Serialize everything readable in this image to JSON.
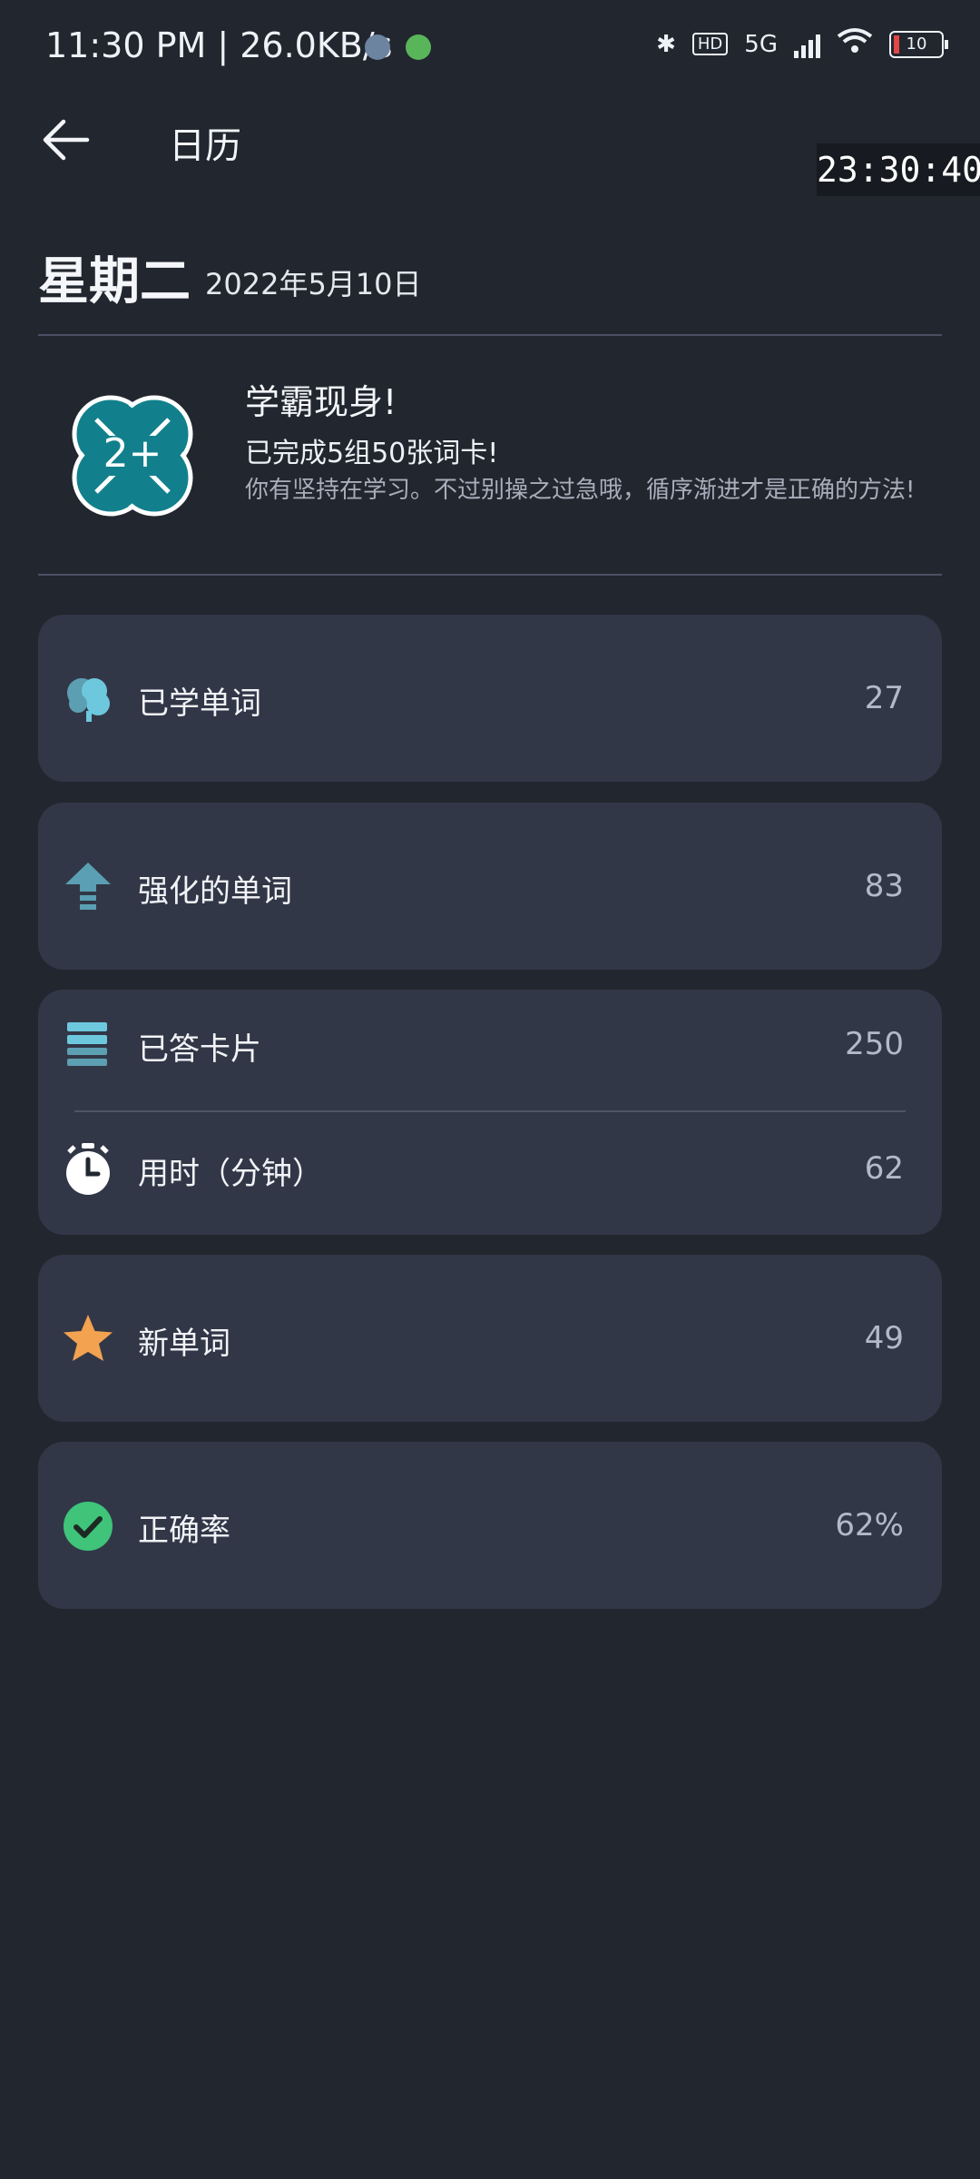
{
  "status_bar": {
    "time": "11:30 PM | 26.0KB/s",
    "network": "5G",
    "hd": "HD",
    "battery": "10"
  },
  "app_bar": {
    "title": "日历",
    "clock": "23:30:40"
  },
  "header": {
    "weekday": "星期二",
    "date": "2022年5月10日"
  },
  "achievement": {
    "badge_text": "2+",
    "title": "学霸现身!",
    "subtitle": "已完成5组50张词卡!",
    "description": "你有坚持在学习。不过别操之过急哦，循序渐进才是正确的方法!"
  },
  "stats": {
    "learned": {
      "label": "已学单词",
      "value": "27",
      "icon": "brain-icon"
    },
    "strengthened": {
      "label": "强化的单词",
      "value": "83",
      "icon": "arrow-up-icon"
    },
    "answered": {
      "label": "已答卡片",
      "value": "250",
      "icon": "cards-stack-icon"
    },
    "time": {
      "label": "用时（分钟）",
      "value": "62",
      "icon": "stopwatch-icon"
    },
    "new_words": {
      "label": "新单词",
      "value": "49",
      "icon": "star-icon"
    },
    "accuracy": {
      "label": "正确率",
      "value": "62%",
      "icon": "check-circle-icon"
    }
  },
  "colors": {
    "background": "#22262f",
    "card": "#323747",
    "badge": "#12808c",
    "star": "#f3a24f",
    "check": "#3fc47a",
    "accent_blue": "#6ec8dd"
  }
}
